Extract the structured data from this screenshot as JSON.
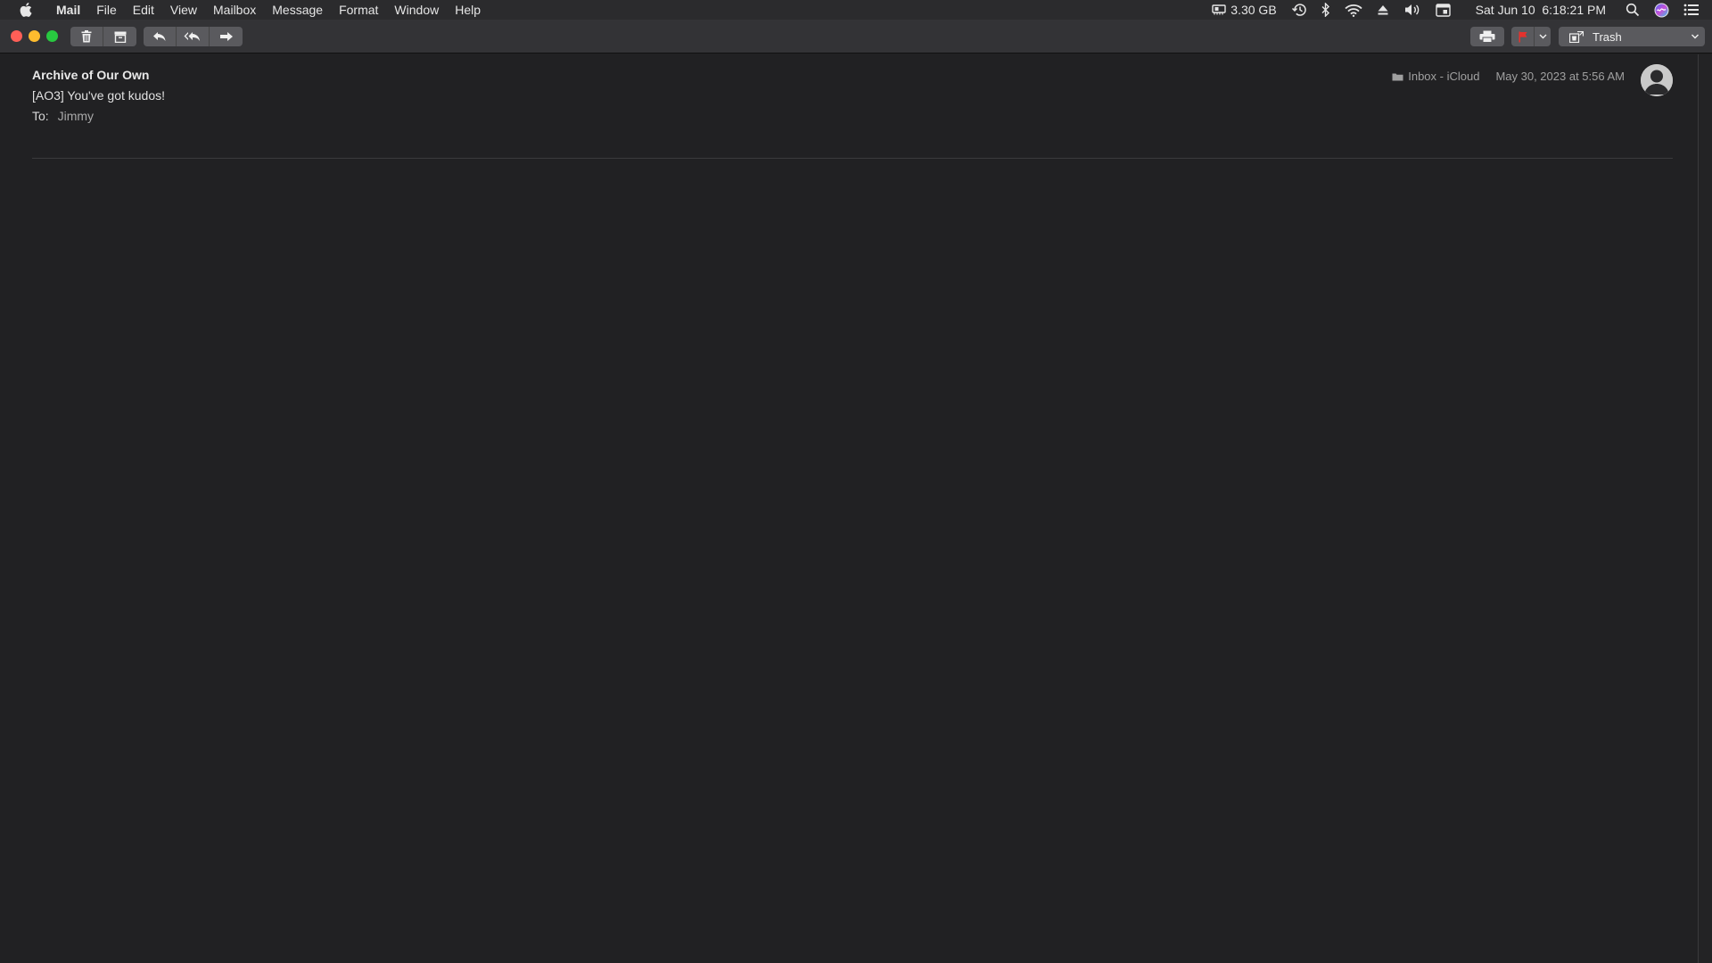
{
  "menubar": {
    "app_name": "Mail",
    "items": [
      "File",
      "Edit",
      "View",
      "Mailbox",
      "Message",
      "Format",
      "Window",
      "Help"
    ],
    "status": {
      "memory": "3.30 GB",
      "datetime": "Sat Jun 10  6:18:21 PM"
    }
  },
  "toolbar": {
    "mailbox": "Trash"
  },
  "message": {
    "sender": "Archive of Our Own",
    "subject": "[AO3] You've got kudos!",
    "to_label": "To:",
    "to_value": "Jimmy",
    "location": "Inbox - iCloud",
    "date": "May 30, 2023 at 5:56 AM"
  },
  "colors": {
    "flag": "#e5322d",
    "close": "#ff5f57",
    "minimize": "#febc2e",
    "maximize": "#28c840"
  }
}
